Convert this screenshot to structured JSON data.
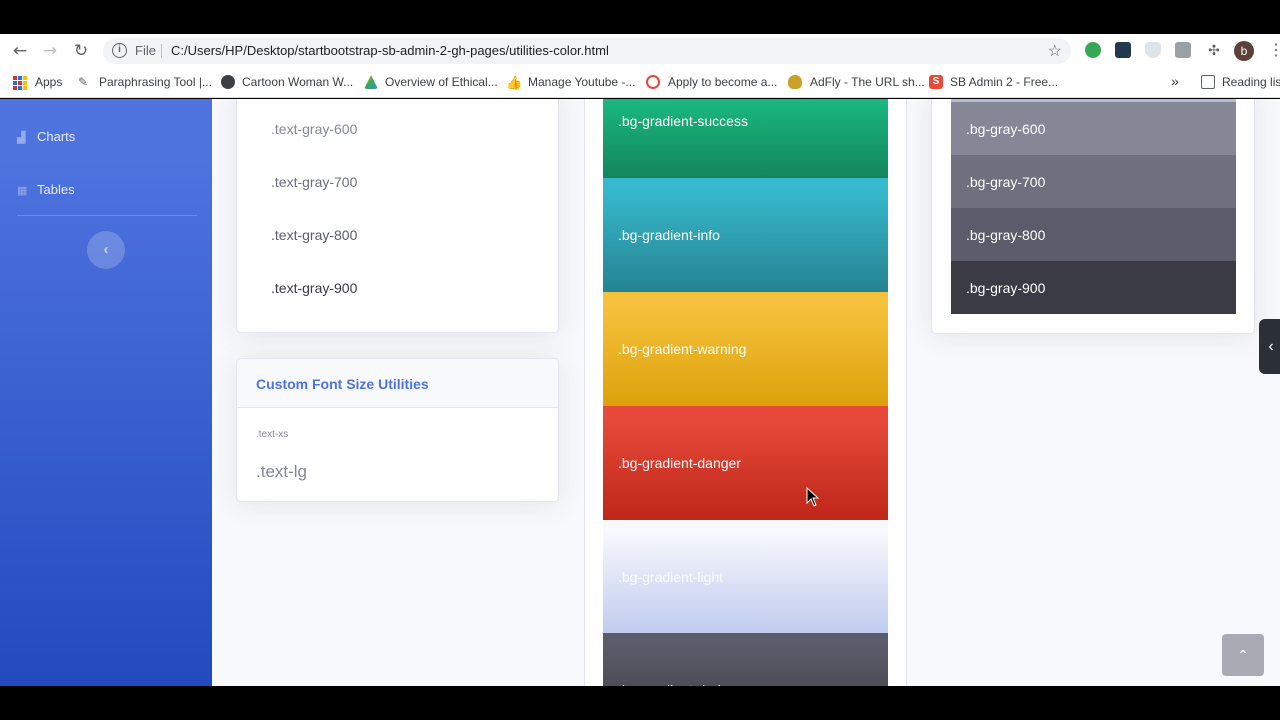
{
  "browser": {
    "file_label": "File",
    "url": "C:/Users/HP/Desktop/startbootstrap-sb-admin-2-gh-pages/utilities-color.html",
    "avatar_letter": "b"
  },
  "bookmarks": {
    "apps": "Apps",
    "items": [
      "Paraphrasing Tool |...",
      "Cartoon Woman W...",
      "Overview of Ethical...",
      "Manage Youtube -...",
      "Apply to become a...",
      "AdFly - The URL sh...",
      "SB Admin 2 - Free..."
    ],
    "more": "»",
    "reading_list": "Reading list"
  },
  "sidebar": {
    "items": [
      {
        "label": "Charts",
        "icon": "chart-area-icon"
      },
      {
        "label": "Tables",
        "icon": "table-icon"
      }
    ]
  },
  "gray_text_card": {
    "items": [
      {
        "label": ".text-gray-600",
        "color": "#858796"
      },
      {
        "label": ".text-gray-700",
        "color": "#6e707e"
      },
      {
        "label": ".text-gray-800",
        "color": "#5a5c69"
      },
      {
        "label": ".text-gray-900",
        "color": "#3a3b45"
      }
    ]
  },
  "font_card": {
    "title": "Custom Font Size Utilities",
    "xs": ".text-xs",
    "lg": ".text-lg"
  },
  "gradient_swatches": [
    {
      "label": ".bg-gradient-success",
      "from": "#1cc88a",
      "to": "#13855c"
    },
    {
      "label": ".bg-gradient-info",
      "from": "#36b9cc",
      "to": "#258391"
    },
    {
      "label": ".bg-gradient-warning",
      "from": "#f6c23e",
      "to": "#dda20a"
    },
    {
      "label": ".bg-gradient-danger",
      "from": "#e74a3b",
      "to": "#be2617"
    },
    {
      "label": ".bg-gradient-light",
      "from": "#f8f9fc",
      "to": "#c0cbef"
    },
    {
      "label": ".bg-gradient-dark",
      "from": "#5a5c69",
      "to": "#373840"
    }
  ],
  "gray_bg_swatches": [
    {
      "label": ".bg-gray-600",
      "color": "#858796"
    },
    {
      "label": ".bg-gray-700",
      "color": "#6e707e"
    },
    {
      "label": ".bg-gray-800",
      "color": "#5a5c69"
    },
    {
      "label": ".bg-gray-900",
      "color": "#3a3b45"
    }
  ]
}
